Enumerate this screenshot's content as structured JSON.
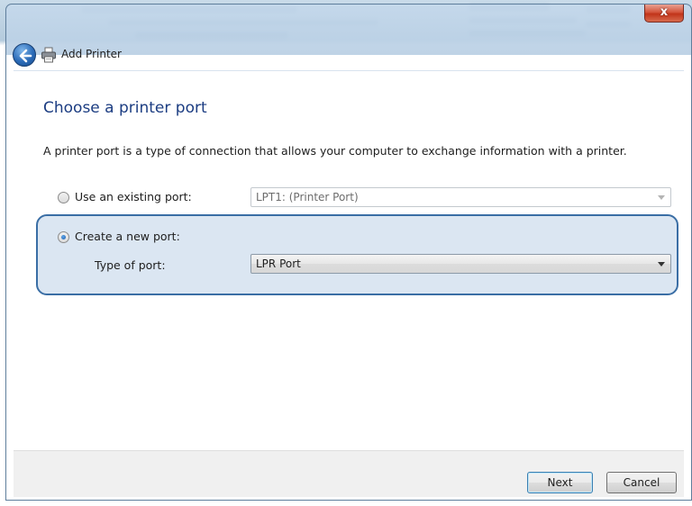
{
  "window": {
    "title": "Add Printer",
    "close_glyph": "x",
    "back_icon": "back-arrow-icon",
    "printer_icon": "printer-icon"
  },
  "page": {
    "heading": "Choose a printer port",
    "description": "A printer port is a type of connection that allows your computer to exchange information with a printer."
  },
  "options": {
    "existing": {
      "label": "Use an existing port:",
      "selected": false,
      "combo_value": "LPT1: (Printer Port)",
      "enabled": false
    },
    "new": {
      "label": "Create a new port:",
      "selected": true,
      "type_label": "Type of port:",
      "combo_value": "LPR Port",
      "enabled": true
    }
  },
  "footer": {
    "next_label": "Next",
    "cancel_label": "Cancel"
  },
  "colors": {
    "heading": "#1c3d82",
    "highlight_border": "#3a6ea5",
    "highlight_fill": "#bed2e8"
  }
}
